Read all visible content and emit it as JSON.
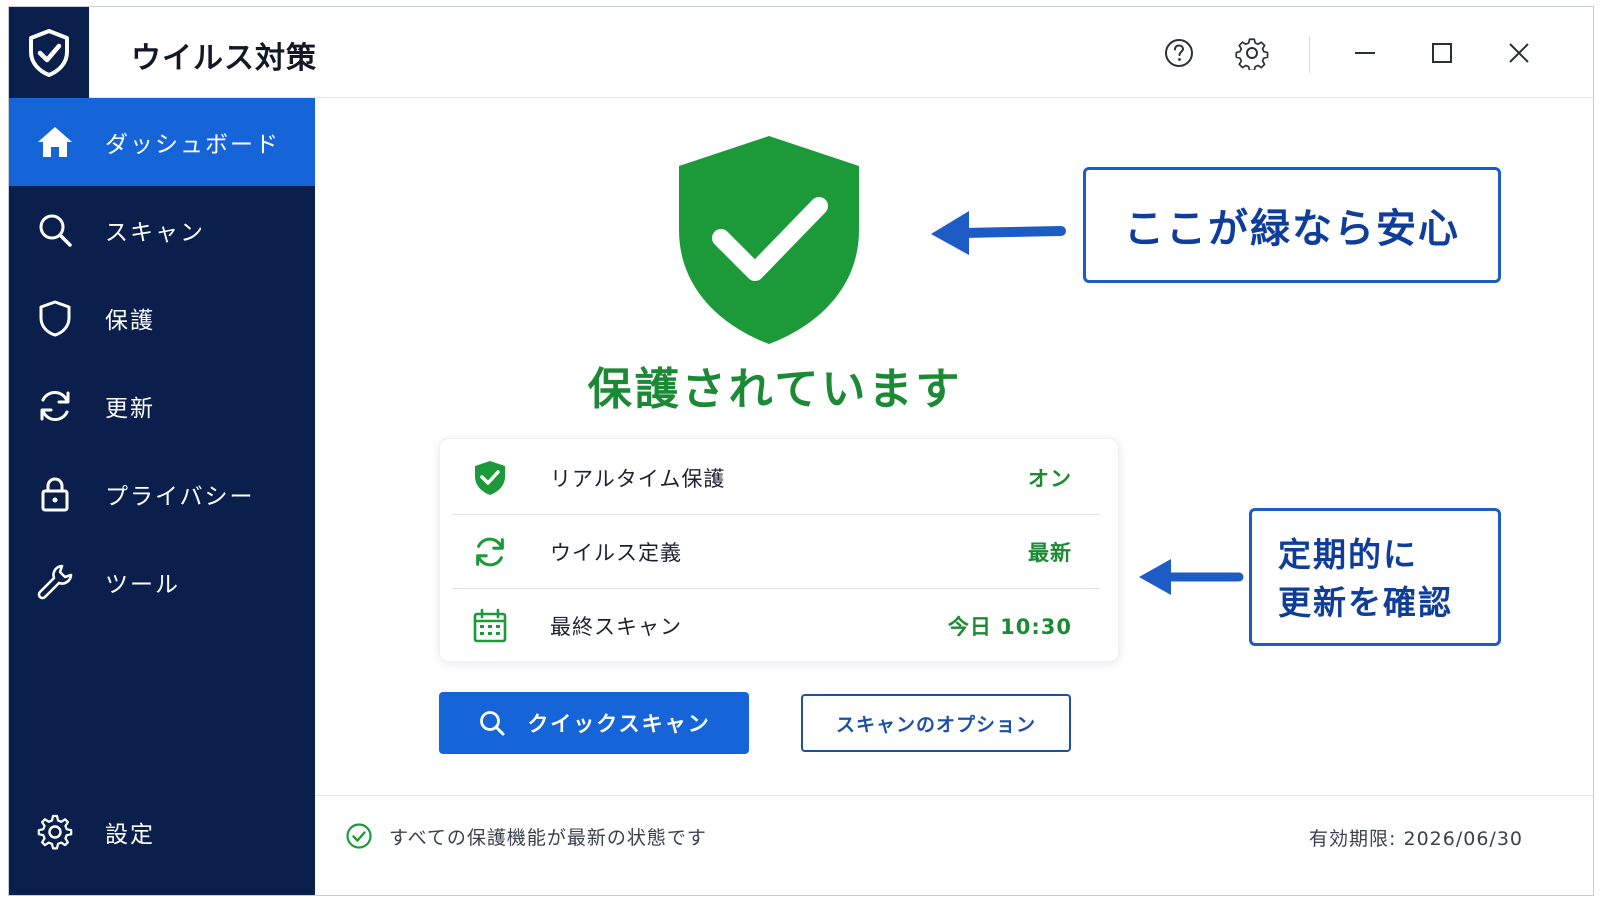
{
  "app": {
    "title": "ウイルス対策",
    "logo_icon": "shield-check-icon"
  },
  "titlebar": {
    "help_icon": "help-icon",
    "settings_icon": "gear-icon",
    "minimize_icon": "minimize-icon",
    "maximize_icon": "maximize-icon",
    "close_icon": "close-icon"
  },
  "sidebar": {
    "items": [
      {
        "label": "ダッシュボード",
        "icon": "home-icon",
        "active": true
      },
      {
        "label": "スキャン",
        "icon": "search-icon",
        "active": false
      },
      {
        "label": "保護",
        "icon": "shield-icon",
        "active": false
      },
      {
        "label": "更新",
        "icon": "refresh-icon",
        "active": false
      },
      {
        "label": "プライバシー",
        "icon": "lock-icon",
        "active": false
      },
      {
        "label": "ツール",
        "icon": "wrench-icon",
        "active": false
      }
    ],
    "settings": {
      "label": "設定",
      "icon": "gear-icon"
    }
  },
  "main": {
    "status_text": "保護されています",
    "status_rows": [
      {
        "label": "リアルタイム保護",
        "value": "オン",
        "icon": "shield-check-icon"
      },
      {
        "label": "ウイルス定義",
        "value": "最新",
        "icon": "refresh-icon"
      },
      {
        "label": "最終スキャン",
        "value": "今日 10:30",
        "icon": "calendar-icon"
      }
    ],
    "quick_scan_label": "クイックスキャン",
    "scan_options_label": "スキャンのオプション"
  },
  "footer": {
    "status": "すべての保護機能が最新の状態です",
    "expiry": "有効期限: 2026/06/30"
  },
  "annotations": {
    "callout_1": "ここが緑なら安心",
    "callout_2_line1": "定期的に",
    "callout_2_line2": "更新を確認"
  },
  "colors": {
    "sidebar_bg": "#0b1f4d",
    "accent_blue": "#1565d8",
    "status_green": "#1c8a34",
    "annotation_blue": "#1d5cc4"
  }
}
